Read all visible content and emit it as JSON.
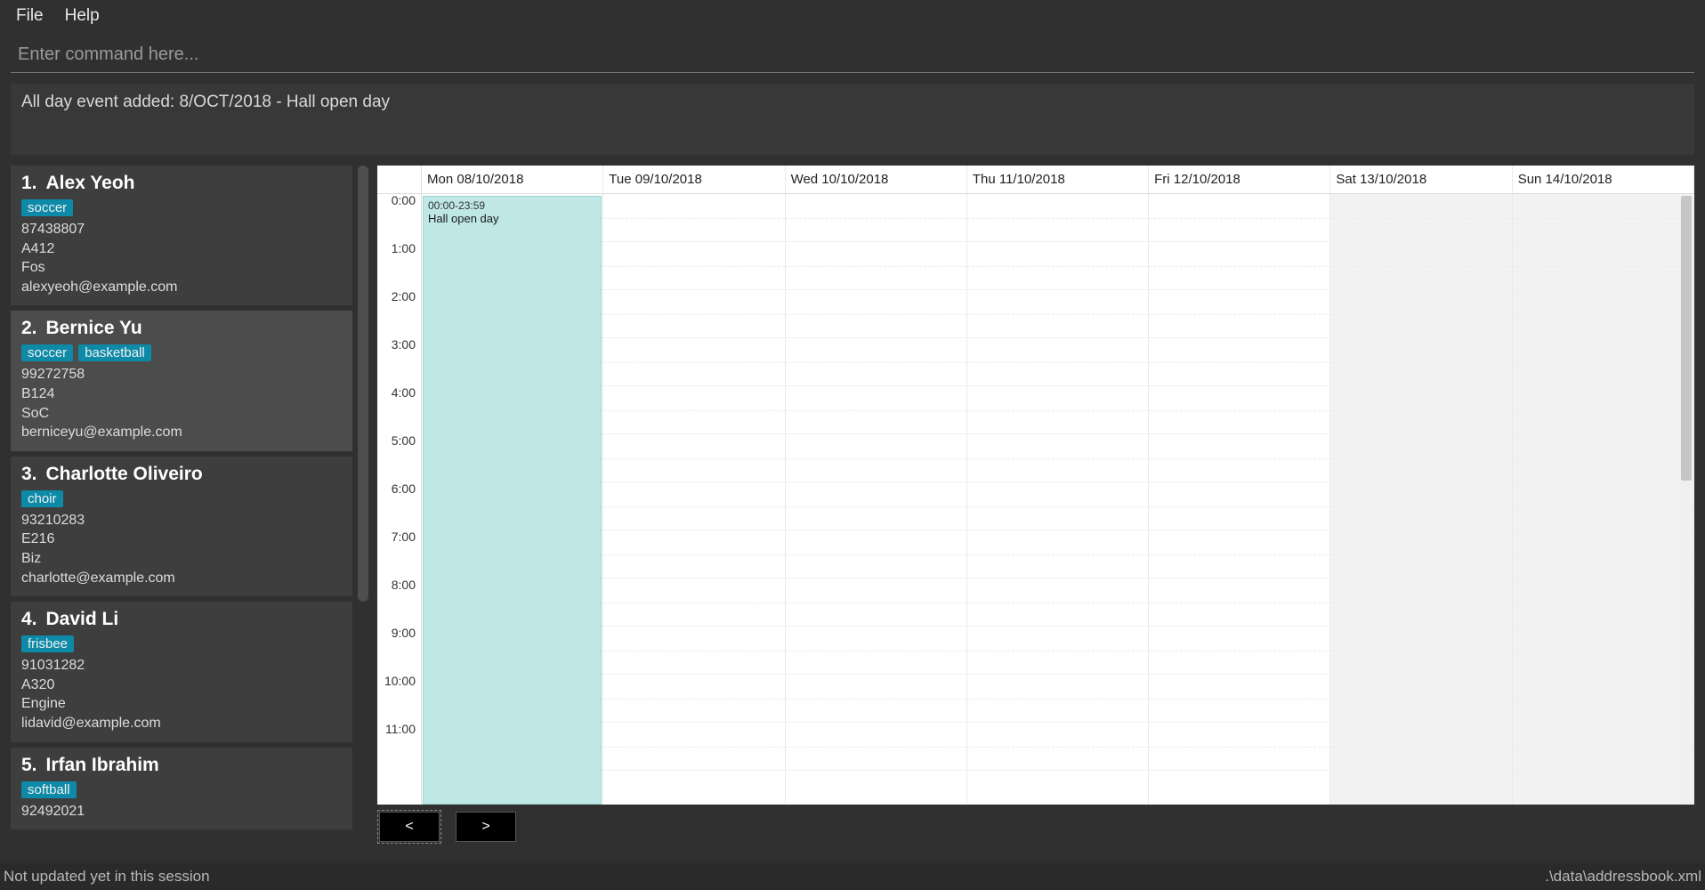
{
  "menu": {
    "file": "File",
    "help": "Help"
  },
  "command": {
    "placeholder": "Enter command here..."
  },
  "result": {
    "text": "All day event added: 8/OCT/2018 - Hall open day"
  },
  "persons": [
    {
      "index": "1.",
      "name": "Alex Yeoh",
      "tags": [
        "soccer"
      ],
      "phone": "87438807",
      "room": "A412",
      "org": "Fos",
      "email": "alexyeoh@example.com",
      "selected": false
    },
    {
      "index": "2.",
      "name": "Bernice Yu",
      "tags": [
        "soccer",
        "basketball"
      ],
      "phone": "99272758",
      "room": "B124",
      "org": "SoC",
      "email": "berniceyu@example.com",
      "selected": true
    },
    {
      "index": "3.",
      "name": "Charlotte Oliveiro",
      "tags": [
        "choir"
      ],
      "phone": "93210283",
      "room": "E216",
      "org": "Biz",
      "email": "charlotte@example.com",
      "selected": false
    },
    {
      "index": "4.",
      "name": "David Li",
      "tags": [
        "frisbee"
      ],
      "phone": "91031282",
      "room": "A320",
      "org": "Engine",
      "email": "lidavid@example.com",
      "selected": false
    },
    {
      "index": "5.",
      "name": "Irfan Ibrahim",
      "tags": [
        "softball"
      ],
      "phone": "92492021",
      "room": "",
      "org": "",
      "email": "",
      "selected": false
    }
  ],
  "calendar": {
    "days": [
      {
        "label": "Mon 08/10/2018",
        "weekend": false
      },
      {
        "label": "Tue 09/10/2018",
        "weekend": false
      },
      {
        "label": "Wed 10/10/2018",
        "weekend": false
      },
      {
        "label": "Thu 11/10/2018",
        "weekend": false
      },
      {
        "label": "Fri 12/10/2018",
        "weekend": false
      },
      {
        "label": "Sat 13/10/2018",
        "weekend": true
      },
      {
        "label": "Sun 14/10/2018",
        "weekend": true
      }
    ],
    "hours": [
      "0:00",
      "1:00",
      "2:00",
      "3:00",
      "4:00",
      "5:00",
      "6:00",
      "7:00",
      "8:00",
      "9:00",
      "10:00",
      "11:00"
    ],
    "event": {
      "dayIndex": 0,
      "time": "00:00-23:59",
      "title": "Hall open day"
    },
    "nav": {
      "prev": "<",
      "next": ">"
    }
  },
  "status": {
    "left": "Not updated yet in this session",
    "right": ".\\data\\addressbook.xml"
  }
}
